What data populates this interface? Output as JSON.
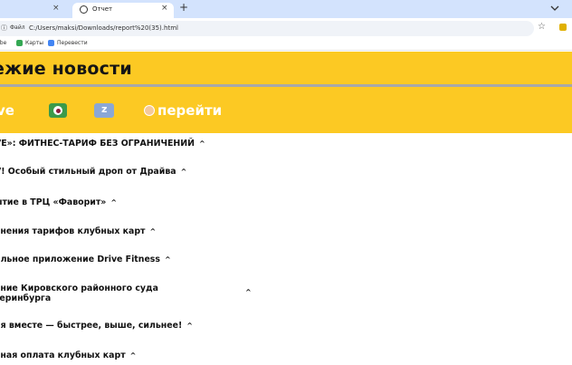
{
  "browser": {
    "prev_tab_close": "×",
    "active_tab_title": "Отчет",
    "active_tab_close": "×",
    "new_tab": "+",
    "scheme_label": "Файл",
    "url": "C:/Users/maksi/Downloads/report%20(35).html",
    "bookmarks": [
      {
        "label": "ube",
        "color": "#ff0000"
      },
      {
        "label": "Карты",
        "color": "#34a853"
      },
      {
        "label": "Перевести",
        "color": "#4285f4"
      }
    ]
  },
  "page": {
    "hero_title": "ежие новости",
    "nav": {
      "left_text": "ve",
      "link_text": "перейти"
    },
    "news": [
      {
        "title": "VE»: ФИТНЕС-ТАРИФ БЕЗ ОГРАНИЧЕНИЙ",
        "chevron": "^"
      },
      {
        "title": "V! Особый стильный дроп от Драйва",
        "chevron": "^"
      },
      {
        "title": "ытие в ТРЦ «Фаворит»",
        "chevron": "^"
      },
      {
        "title": "енения тарифов клубных карт",
        "chevron": "^"
      },
      {
        "title": "ильное приложение Drive Fitness",
        "chevron": "^"
      },
      {
        "title_line1": "ение Кировского районного суда",
        "title_line2": "теринбурга",
        "chevron": "^"
      },
      {
        "title": "ия вместе — быстрее, выше, сильнее!",
        "chevron": "^"
      },
      {
        "title": "чная оплата клубных карт",
        "chevron": "^"
      }
    ]
  }
}
